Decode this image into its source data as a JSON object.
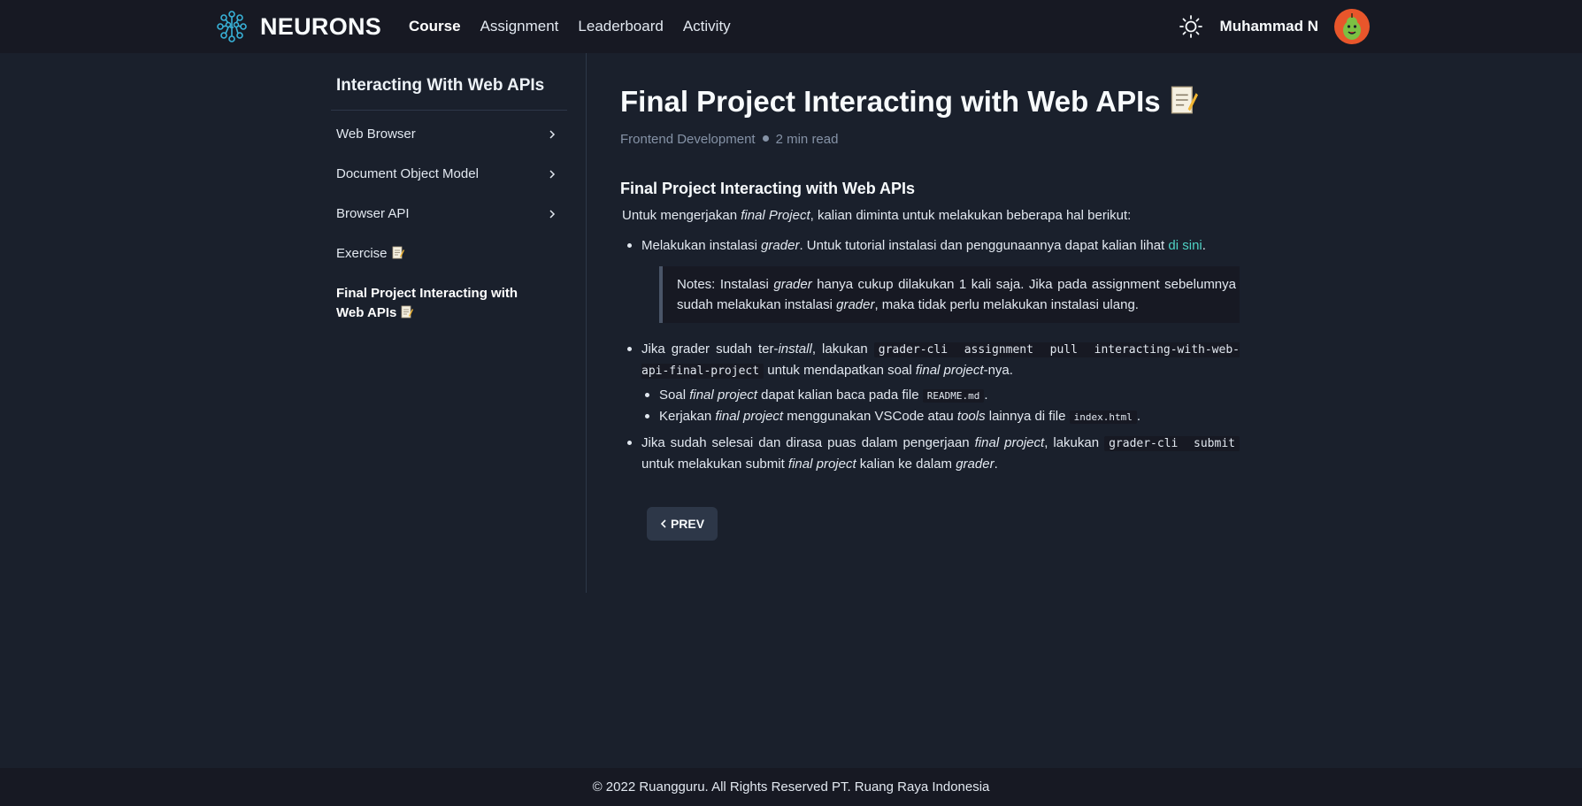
{
  "navbar": {
    "brand": "NEURONS",
    "links": [
      "Course",
      "Assignment",
      "Leaderboard",
      "Activity"
    ],
    "active_link": "Course",
    "user_name": "Muhammad N"
  },
  "sidebar": {
    "title": "Interacting With Web APIs",
    "items": [
      {
        "label": "Web Browser"
      },
      {
        "label": "Document Object Model"
      },
      {
        "label": "Browser API"
      },
      {
        "label": "Exercise"
      },
      {
        "label": "Final Project Interacting with Web APIs",
        "active": true
      }
    ]
  },
  "main": {
    "title": "Final Project Interacting with Web APIs",
    "category": "Frontend Development",
    "read_time": "2 min read",
    "heading": "Final Project Interacting with Web APIs",
    "intro": {
      "a": "Untuk mengerjakan ",
      "b": "final Project",
      "c": ", kalian diminta untuk melakukan beberapa hal berikut:"
    },
    "step1": {
      "a": "Melakukan instalasi ",
      "b": "grader",
      "c": ". Untuk tutorial instalasi dan penggunaannya dapat kalian lihat ",
      "link": "di sini",
      "d": "."
    },
    "note": {
      "a": "Notes: Instalasi ",
      "b": "grader",
      "c": " hanya cukup dilakukan 1 kali saja. Jika pada assignment sebelumnya sudah melakukan instalasi ",
      "d": "grader",
      "e": ", maka tidak perlu melakukan instalasi ulang."
    },
    "step2": {
      "a": "Jika grader sudah ter-",
      "b": "install",
      "c": ", lakukan ",
      "code": "grader-cli assignment pull interacting-with-web-api-final-project",
      "d": " untuk mendapatkan soal ",
      "e": "final project",
      "f": "-nya."
    },
    "sub1": {
      "a": "Soal ",
      "b": "final project",
      "c": " dapat kalian baca pada file ",
      "code": "README.md",
      "d": "."
    },
    "sub2": {
      "a": "Kerjakan ",
      "b": "final project",
      "c": " menggunakan VSCode atau ",
      "d": "tools",
      "e": " lainnya di file ",
      "code": "index.html",
      "f": "."
    },
    "step3": {
      "a": "Jika sudah selesai dan dirasa puas dalam pengerjaan ",
      "b": "final project",
      "c": ", lakukan ",
      "code": "grader-cli submit",
      "d": " untuk melakukan submit ",
      "e": "final project",
      "f": " kalian ke dalam ",
      "g": "grader",
      "h": "."
    },
    "prev_label": "PREV"
  },
  "footer": {
    "text": "© 2022 Ruangguru. All Rights Reserved PT. Ruang Raya Indonesia"
  }
}
